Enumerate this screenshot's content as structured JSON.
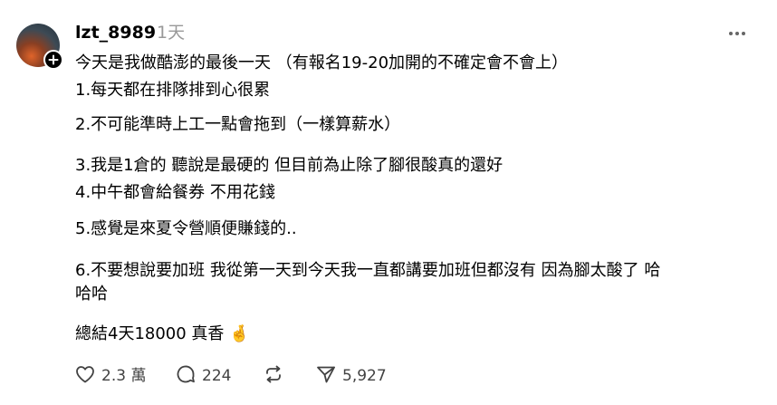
{
  "post": {
    "username": "lzt_8989",
    "time": "1天",
    "lines": [
      "今天是我做酷澎的最後一天 （有報名19-20加開的不確定會不會上）",
      "1.每天都在排隊排到心很累",
      "2.不可能準時上工一點會拖到（一樣算薪水）",
      "3.我是1倉的 聽說是最硬的 但目前為止除了腳很酸真的還好",
      "4.中午都會給餐券 不用花錢",
      "5.感覺是來夏令營順便賺錢的..",
      "6.不要想說要加班 我從第一天到今天我一直都講要加班但都沒有 因為腳太酸了 哈",
      "哈哈",
      "總結4天18000 真香 🤞"
    ],
    "icons": {
      "avatar_badge": "plus-icon",
      "menu": "more-horizontal-icon",
      "emoji": "crossed-fingers-icon"
    }
  },
  "actions": {
    "likes": "2.3 萬",
    "comments": "224",
    "reposts": "",
    "shares": "5,927",
    "icon_names": [
      "heart-icon",
      "comment-icon",
      "repost-icon",
      "send-icon"
    ]
  }
}
